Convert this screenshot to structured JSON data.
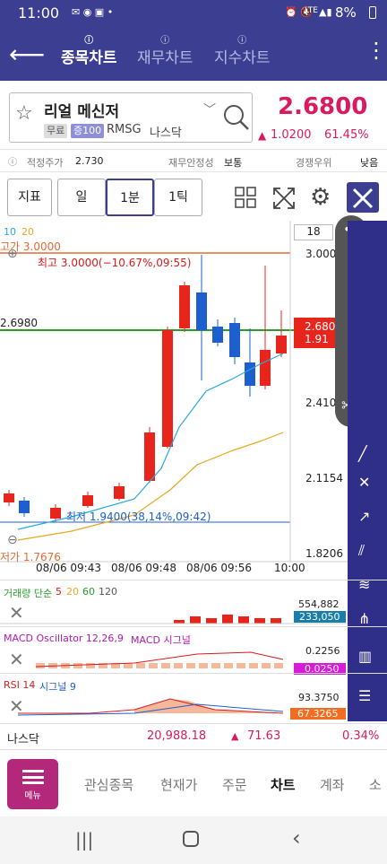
{
  "status": {
    "time": "11:00",
    "battery": "8%",
    "signal": "LTE"
  },
  "tabs": [
    {
      "label": "종목차트",
      "active": true
    },
    {
      "label": "재무차트",
      "active": false
    },
    {
      "label": "지수차트",
      "active": false
    }
  ],
  "stock": {
    "name": "리얼 메신저",
    "badge_free": "무료",
    "badge_margin": "증100",
    "ticker": "RMSG",
    "market": "나스닥",
    "price": "2.6800",
    "change": "1.0200",
    "change_pct": "61.45%"
  },
  "info": {
    "fair_label": "적정주가",
    "fair_value": "2.730",
    "stability_label": "재무안정성",
    "stability_value": "보통",
    "rank_label": "경쟁우위",
    "rank_value": "낮음"
  },
  "toolbar": {
    "indicator": "지표",
    "day": "일",
    "minute": "1분",
    "tick": "1틱"
  },
  "chart": {
    "ma_legend": [
      "10",
      "20"
    ],
    "period_box": "18",
    "high_label": "고가 3.0000",
    "max_label": "최고 3.0000(−10.67%,09:55)",
    "min_label": "최저 1.9400(38,14%,09:42)",
    "low_label": "저가 1.7676",
    "h_line_value": "2.6980",
    "price_tag": "2.680",
    "price_tag2": "1.91",
    "y_ticks": [
      "3.000",
      "2.410",
      "2.1154",
      "1.8206"
    ],
    "x_ticks": [
      "08/06 09:43",
      "08/06 09:48",
      "08/06 09:56",
      "10:00"
    ],
    "colors": {
      "up": "#e8251c",
      "down": "#1e5fcf",
      "ma10": "#29a9e1",
      "ma20": "#e6a81f",
      "hline": "#2a9d2a",
      "highline": "#e06b35"
    }
  },
  "volume": {
    "title": "거래량 단순",
    "p1": "5",
    "p2": "20",
    "p3": "60",
    "p4": "120",
    "top": "554,882",
    "tag": "233,050"
  },
  "macd": {
    "title": "MACD Oscillator 12,26,9",
    "title2": "MACD 시그널",
    "top": "0.2256",
    "tag": "0.0250"
  },
  "rsi": {
    "title": "RSI 14",
    "title2": "시그널 9",
    "top": "93.3750",
    "tag": "67.3265"
  },
  "chart_data": {
    "type": "candlestick",
    "x": [
      "08/06 09:43",
      "08/06 09:48",
      "08/06 09:56",
      "10:00"
    ],
    "ylim": [
      1.7676,
      3.0
    ],
    "high": 3.0,
    "low": 1.94,
    "last": 2.68,
    "reference": 2.698
  },
  "ticker_bar": {
    "name": "나스닥",
    "value": "20,988.18",
    "change": "71.63",
    "pct": "0.34%"
  },
  "menu": {
    "label": "메뉴"
  },
  "nav": [
    "관심종목",
    "현재가",
    "주문",
    "차트",
    "계좌",
    "소"
  ]
}
